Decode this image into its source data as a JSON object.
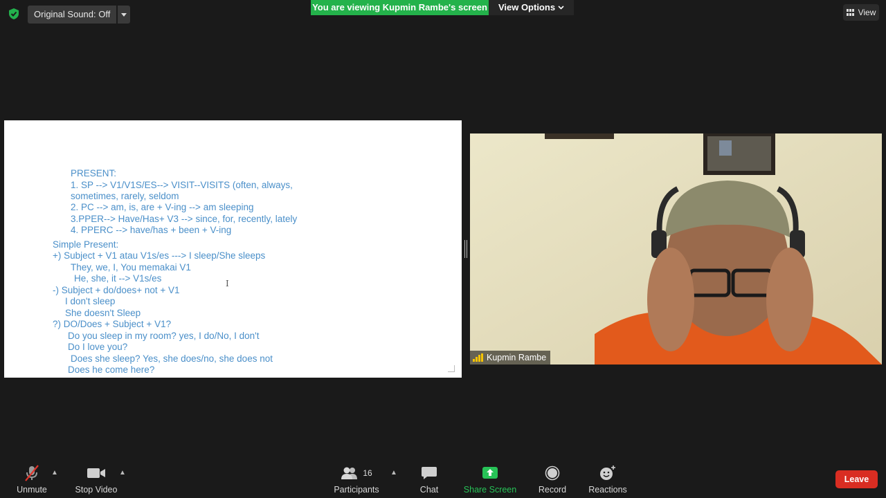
{
  "top_bar": {
    "original_sound": "Original Sound: Off",
    "viewing_banner": "You are viewing Kupmin Rambe's screen",
    "view_options": "View Options",
    "view": "View"
  },
  "slide": {
    "lines": [
      "PRESENT:",
      "1. SP --> V1/V1S/ES--> VISIT--VISITS (often, always,",
      "sometimes, rarely, seldom",
      "2. PC --> am, is, are + V-ing --> am sleeping",
      "3.PPER--> Have/Has+ V3 --> since, for, recently, lately",
      "4. PPERC --> have/has + been + V-ing",
      "Simple Present:",
      "+) Subject + V1 atau V1s/es ---> I sleep/She sleeps",
      "They, we, I, You memakai V1",
      "He, she, it --> V1s/es",
      "-) Subject + do/does+ not + V1",
      "I don't sleep",
      "She doesn't Sleep",
      "?) DO/Does + Subject + V1?",
      "Do you sleep in my room? yes, I do/No, I don't",
      "Do I love you?",
      "Does she sleep? Yes, she does/no, she does not",
      "Does he come here?"
    ]
  },
  "participant_video": {
    "name": "Kupmin Rambe"
  },
  "toolbar": {
    "unmute": "Unmute",
    "stop_video": "Stop Video",
    "participants": "Participants",
    "participants_count": "16",
    "chat": "Chat",
    "share_screen": "Share Screen",
    "record": "Record",
    "reactions": "Reactions",
    "leave": "Leave"
  },
  "colors": {
    "banner_green": "#24b24b",
    "share_green": "#27c257",
    "leave_red": "#d92d22",
    "slide_text_blue": "#4a8fc9",
    "background": "#1a1a1a"
  }
}
